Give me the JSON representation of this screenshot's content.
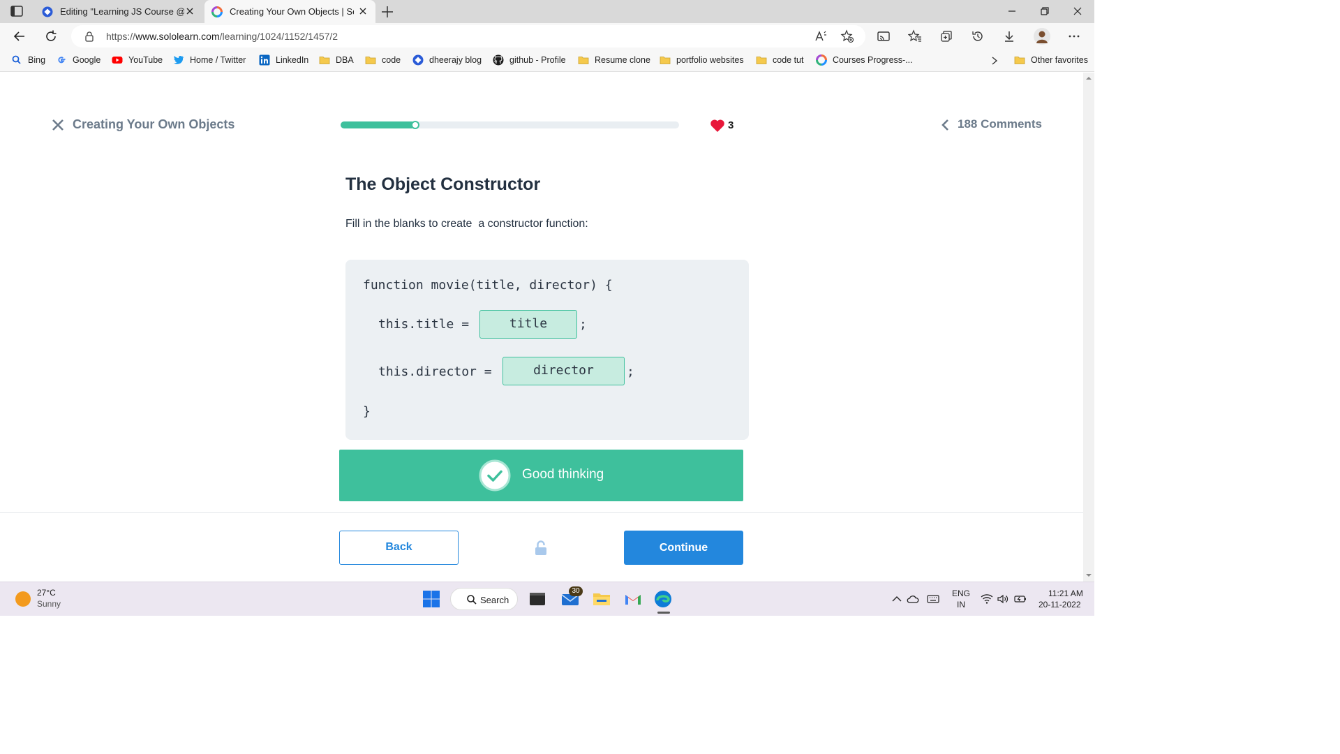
{
  "browser": {
    "tabs": [
      {
        "title": "Editing \"Learning JS Course @Sololearn\"",
        "active": false
      },
      {
        "title": "Creating Your Own Objects | Sololearn",
        "active": true
      }
    ],
    "url_prefix": "https://",
    "url_host": "www.sololearn.com",
    "url_path": "/learning/1024/1152/1457/2",
    "bookmarks": [
      {
        "label": "Bing",
        "icon": "search-icon"
      },
      {
        "label": "Google",
        "icon": "google-icon"
      },
      {
        "label": "YouTube",
        "icon": "youtube-icon"
      },
      {
        "label": "Home / Twitter",
        "icon": "twitter-icon"
      },
      {
        "label": "LinkedIn",
        "icon": "linkedin-icon"
      },
      {
        "label": "DBA",
        "icon": "folder-icon"
      },
      {
        "label": "code",
        "icon": "folder-icon"
      },
      {
        "label": "dheerajy blog",
        "icon": "blog-icon"
      },
      {
        "label": "github - Profile",
        "icon": "github-icon"
      },
      {
        "label": "Resume clone",
        "icon": "folder-icon"
      },
      {
        "label": "portfolio websites",
        "icon": "folder-icon"
      },
      {
        "label": "code tut",
        "icon": "folder-icon"
      },
      {
        "label": "Courses Progress-...",
        "icon": "sololearn-icon"
      }
    ],
    "other_favorites": "Other favorites"
  },
  "lesson": {
    "title": "Creating Your Own Objects",
    "progress": 0.22,
    "lives": "3",
    "comments": "188 Comments",
    "heading": "The Object Constructor",
    "instruction": "Fill in the blanks to create  a constructor function:",
    "code": {
      "line1": "function movie(title, director) {",
      "line2_prefix": "this.title = ",
      "blank1": "title",
      "line2_suffix": ";",
      "line3_prefix": "this.director = ",
      "blank2": "director",
      "line3_suffix": ";",
      "line4": "}"
    },
    "feedback": "Good thinking",
    "back_label": "Back",
    "continue_label": "Continue"
  },
  "colors": {
    "accent_green": "#3ec09c",
    "accent_blue": "#2387dd",
    "heart_red": "#e8173a"
  },
  "taskbar": {
    "temperature": "27°C",
    "weather": "Sunny",
    "search_label": "Search",
    "mail_badge": "30",
    "lang_top": "ENG",
    "lang_bottom": "IN",
    "time": "11:21 AM",
    "date": "20-11-2022"
  }
}
